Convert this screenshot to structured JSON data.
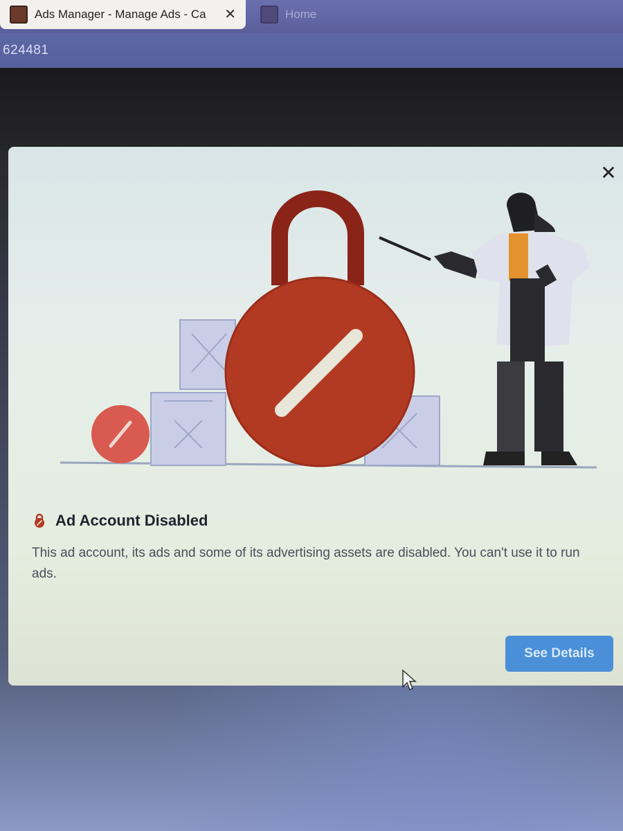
{
  "browser": {
    "tabs": [
      {
        "title": "Ads Manager - Manage Ads - Ca",
        "active": true
      },
      {
        "title": "Home",
        "active": false
      }
    ],
    "url_fragment": "624481"
  },
  "modal": {
    "title": "Ad Account Disabled",
    "message": "This ad account, its ads and some of its advertising assets are disabled. You can't use it to run ads.",
    "primary_button": "See Details"
  },
  "colors": {
    "lock_red": "#b33a22",
    "lock_shackle": "#8a2318",
    "button_blue": "#4a8fd8",
    "tab_bar": "#5a5f9c"
  },
  "icons": {
    "tab_close": "close-icon",
    "modal_close": "close-icon",
    "title_icon": "lock-icon",
    "cursor": "mouse-pointer-icon"
  }
}
